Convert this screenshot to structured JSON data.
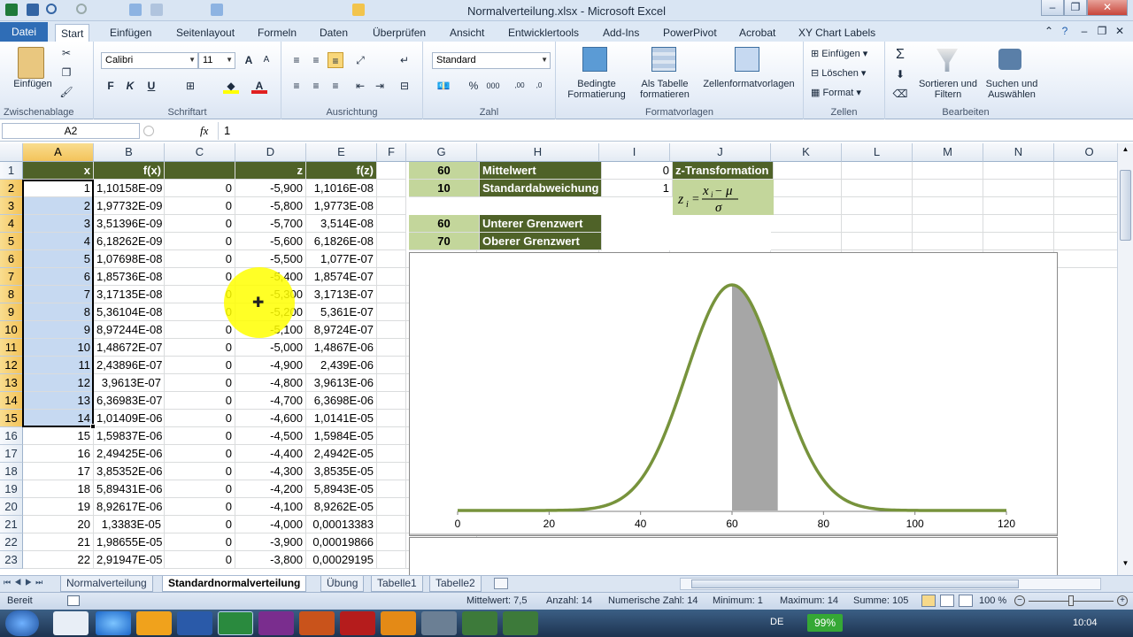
{
  "title": "Normalverteilung.xlsx - Microsoft Excel",
  "tabs": [
    "Datei",
    "Start",
    "Einfügen",
    "Seitenlayout",
    "Formeln",
    "Daten",
    "Überprüfen",
    "Ansicht",
    "Entwicklertools",
    "Add-Ins",
    "PowerPivot",
    "Acrobat",
    "XY Chart Labels"
  ],
  "ribbon": {
    "clipboard": {
      "paste": "Einfügen",
      "label": "Zwischenablage"
    },
    "font": {
      "name": "Calibri",
      "size": "11",
      "label": "Schriftart"
    },
    "alignment": {
      "label": "Ausrichtung"
    },
    "number": {
      "format": "Standard",
      "label": "Zahl"
    },
    "styles": {
      "cond": "Bedingte Formatierung",
      "table": "Als Tabelle formatieren",
      "cell": "Zellenformatvorlagen",
      "label": "Formatvorlagen"
    },
    "cells": {
      "insert": "Einfügen",
      "delete": "Löschen",
      "format": "Format",
      "label": "Zellen"
    },
    "editing": {
      "sort": "Sortieren und Filtern",
      "find": "Suchen und Auswählen",
      "label": "Bearbeiten"
    }
  },
  "formula_bar": {
    "name_box": "A2",
    "fx": "fx",
    "value": "1"
  },
  "columns": [
    "A",
    "B",
    "C",
    "D",
    "E",
    "F",
    "G",
    "H",
    "I",
    "J",
    "K",
    "L",
    "M",
    "N",
    "O"
  ],
  "rows": [
    "1",
    "2",
    "3",
    "4",
    "5",
    "6",
    "7",
    "8",
    "9",
    "10",
    "11",
    "12",
    "13",
    "14",
    "15",
    "16",
    "17",
    "18",
    "19",
    "20",
    "21",
    "22",
    "23"
  ],
  "table": {
    "headers": [
      "x",
      "f(x)",
      "",
      "z",
      "f(z)"
    ],
    "data": [
      [
        "1",
        "1,10158E-09",
        "0",
        "-5,900",
        "1,1016E-08"
      ],
      [
        "2",
        "1,97732E-09",
        "0",
        "-5,800",
        "1,9773E-08"
      ],
      [
        "3",
        "3,51396E-09",
        "0",
        "-5,700",
        "3,514E-08"
      ],
      [
        "4",
        "6,18262E-09",
        "0",
        "-5,600",
        "6,1826E-08"
      ],
      [
        "5",
        "1,07698E-08",
        "0",
        "-5,500",
        "1,077E-07"
      ],
      [
        "6",
        "1,85736E-08",
        "0",
        "-5,400",
        "1,8574E-07"
      ],
      [
        "7",
        "3,17135E-08",
        "0",
        "-5,300",
        "3,1713E-07"
      ],
      [
        "8",
        "5,36104E-08",
        "0",
        "-5,200",
        "5,361E-07"
      ],
      [
        "9",
        "8,97244E-08",
        "0",
        "-5,100",
        "8,9724E-07"
      ],
      [
        "10",
        "1,48672E-07",
        "0",
        "-5,000",
        "1,4867E-06"
      ],
      [
        "11",
        "2,43896E-07",
        "0",
        "-4,900",
        "2,439E-06"
      ],
      [
        "12",
        "3,9613E-07",
        "0",
        "-4,800",
        "3,9613E-06"
      ],
      [
        "13",
        "6,36983E-07",
        "0",
        "-4,700",
        "6,3698E-06"
      ],
      [
        "14",
        "1,01409E-06",
        "0",
        "-4,600",
        "1,0141E-05"
      ],
      [
        "15",
        "1,59837E-06",
        "0",
        "-4,500",
        "1,5984E-05"
      ],
      [
        "16",
        "2,49425E-06",
        "0",
        "-4,400",
        "2,4942E-05"
      ],
      [
        "17",
        "3,85352E-06",
        "0",
        "-4,300",
        "3,8535E-05"
      ],
      [
        "18",
        "5,89431E-06",
        "0",
        "-4,200",
        "5,8943E-05"
      ],
      [
        "19",
        "8,92617E-06",
        "0",
        "-4,100",
        "8,9262E-05"
      ],
      [
        "20",
        "1,3383E-05",
        "0",
        "-4,000",
        "0,00013383"
      ],
      [
        "21",
        "1,98655E-05",
        "0",
        "-3,900",
        "0,00019866"
      ],
      [
        "22",
        "2,91947E-05",
        "0",
        "-3,800",
        "0,00029195"
      ]
    ]
  },
  "params": {
    "mean_value": "60",
    "mean_label": "Mittelwert",
    "mean_i": "0",
    "sd_value": "10",
    "sd_label": "Standardabweichung",
    "sd_i": "1",
    "lower_value": "60",
    "lower_label": "Unterer Grenzwert",
    "upper_value": "70",
    "upper_label": "Oberer Grenzwert",
    "ztrans_label": "z-Transformation"
  },
  "chart_data": {
    "type": "area",
    "title": "",
    "xlabel": "",
    "ylabel": "",
    "xlim": [
      0,
      120
    ],
    "xticks": [
      "0",
      "20",
      "40",
      "60",
      "80",
      "100",
      "120"
    ],
    "series": [
      {
        "mean": 60,
        "sd": 10
      }
    ],
    "shaded_range": [
      60,
      70
    ],
    "line_color": "#77933c",
    "fill_color": "#a6a6a6"
  },
  "sheet_tabs": [
    "Normalverteilung",
    "Standardnormalverteilung",
    "Übung",
    "Tabelle1",
    "Tabelle2"
  ],
  "status": {
    "ready": "Bereit",
    "avg": "Mittelwert: 7,5",
    "count": "Anzahl: 14",
    "numcount": "Numerische Zahl: 14",
    "min": "Minimum: 1",
    "max": "Maximum: 14",
    "sum": "Summe: 105",
    "zoom": "100 %"
  },
  "taskbar": {
    "lang": "DE",
    "battery": "99%",
    "time": "10:04"
  }
}
